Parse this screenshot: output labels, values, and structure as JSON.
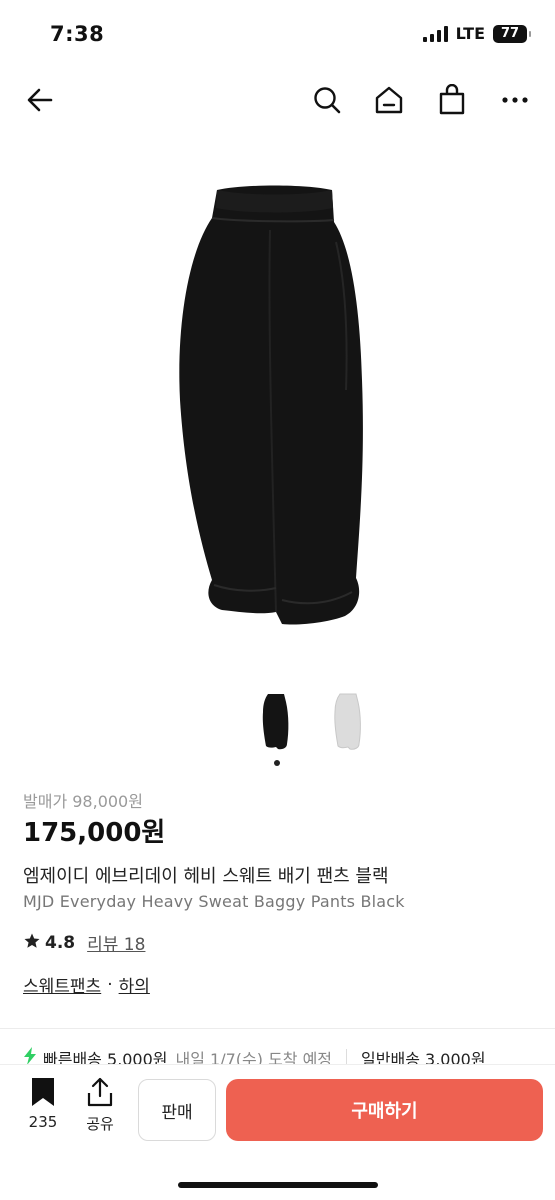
{
  "status_bar": {
    "time": "7:38",
    "network": "LTE",
    "battery": "77"
  },
  "nav": {
    "back_icon": "back-arrow-icon",
    "search_icon": "search-icon",
    "home_icon": "home-icon",
    "bag_icon": "shopping-bag-icon",
    "more_icon": "more-dots-icon"
  },
  "gallery": {
    "images": [
      "black-pants",
      "grey-pants"
    ],
    "selected_index": 0
  },
  "product": {
    "list_price": "발매가 98,000원",
    "price": "175,000원",
    "title_ko": "엠제이디 에브리데이 헤비 스웨트 배기 팬츠 블랙",
    "title_en": "MJD Everyday Heavy Sweat Baggy Pants Black",
    "rating": "4.8",
    "review_label": "리뷰 18",
    "categories": [
      "스웨트팬츠",
      "하의"
    ],
    "category_separator": "·"
  },
  "shipping": {
    "fast_label": "빠른배송 5,000원",
    "fast_eta": "내일 1/7(수) 도착 예정",
    "normal_label": "일반배송 3,000원"
  },
  "bottom_bar": {
    "bookmark_count": "235",
    "share_label": "공유",
    "sell_label": "판매",
    "buy_label": "구매하기"
  },
  "colors": {
    "accent": "#ee6151",
    "flash": "#2fcf63"
  }
}
